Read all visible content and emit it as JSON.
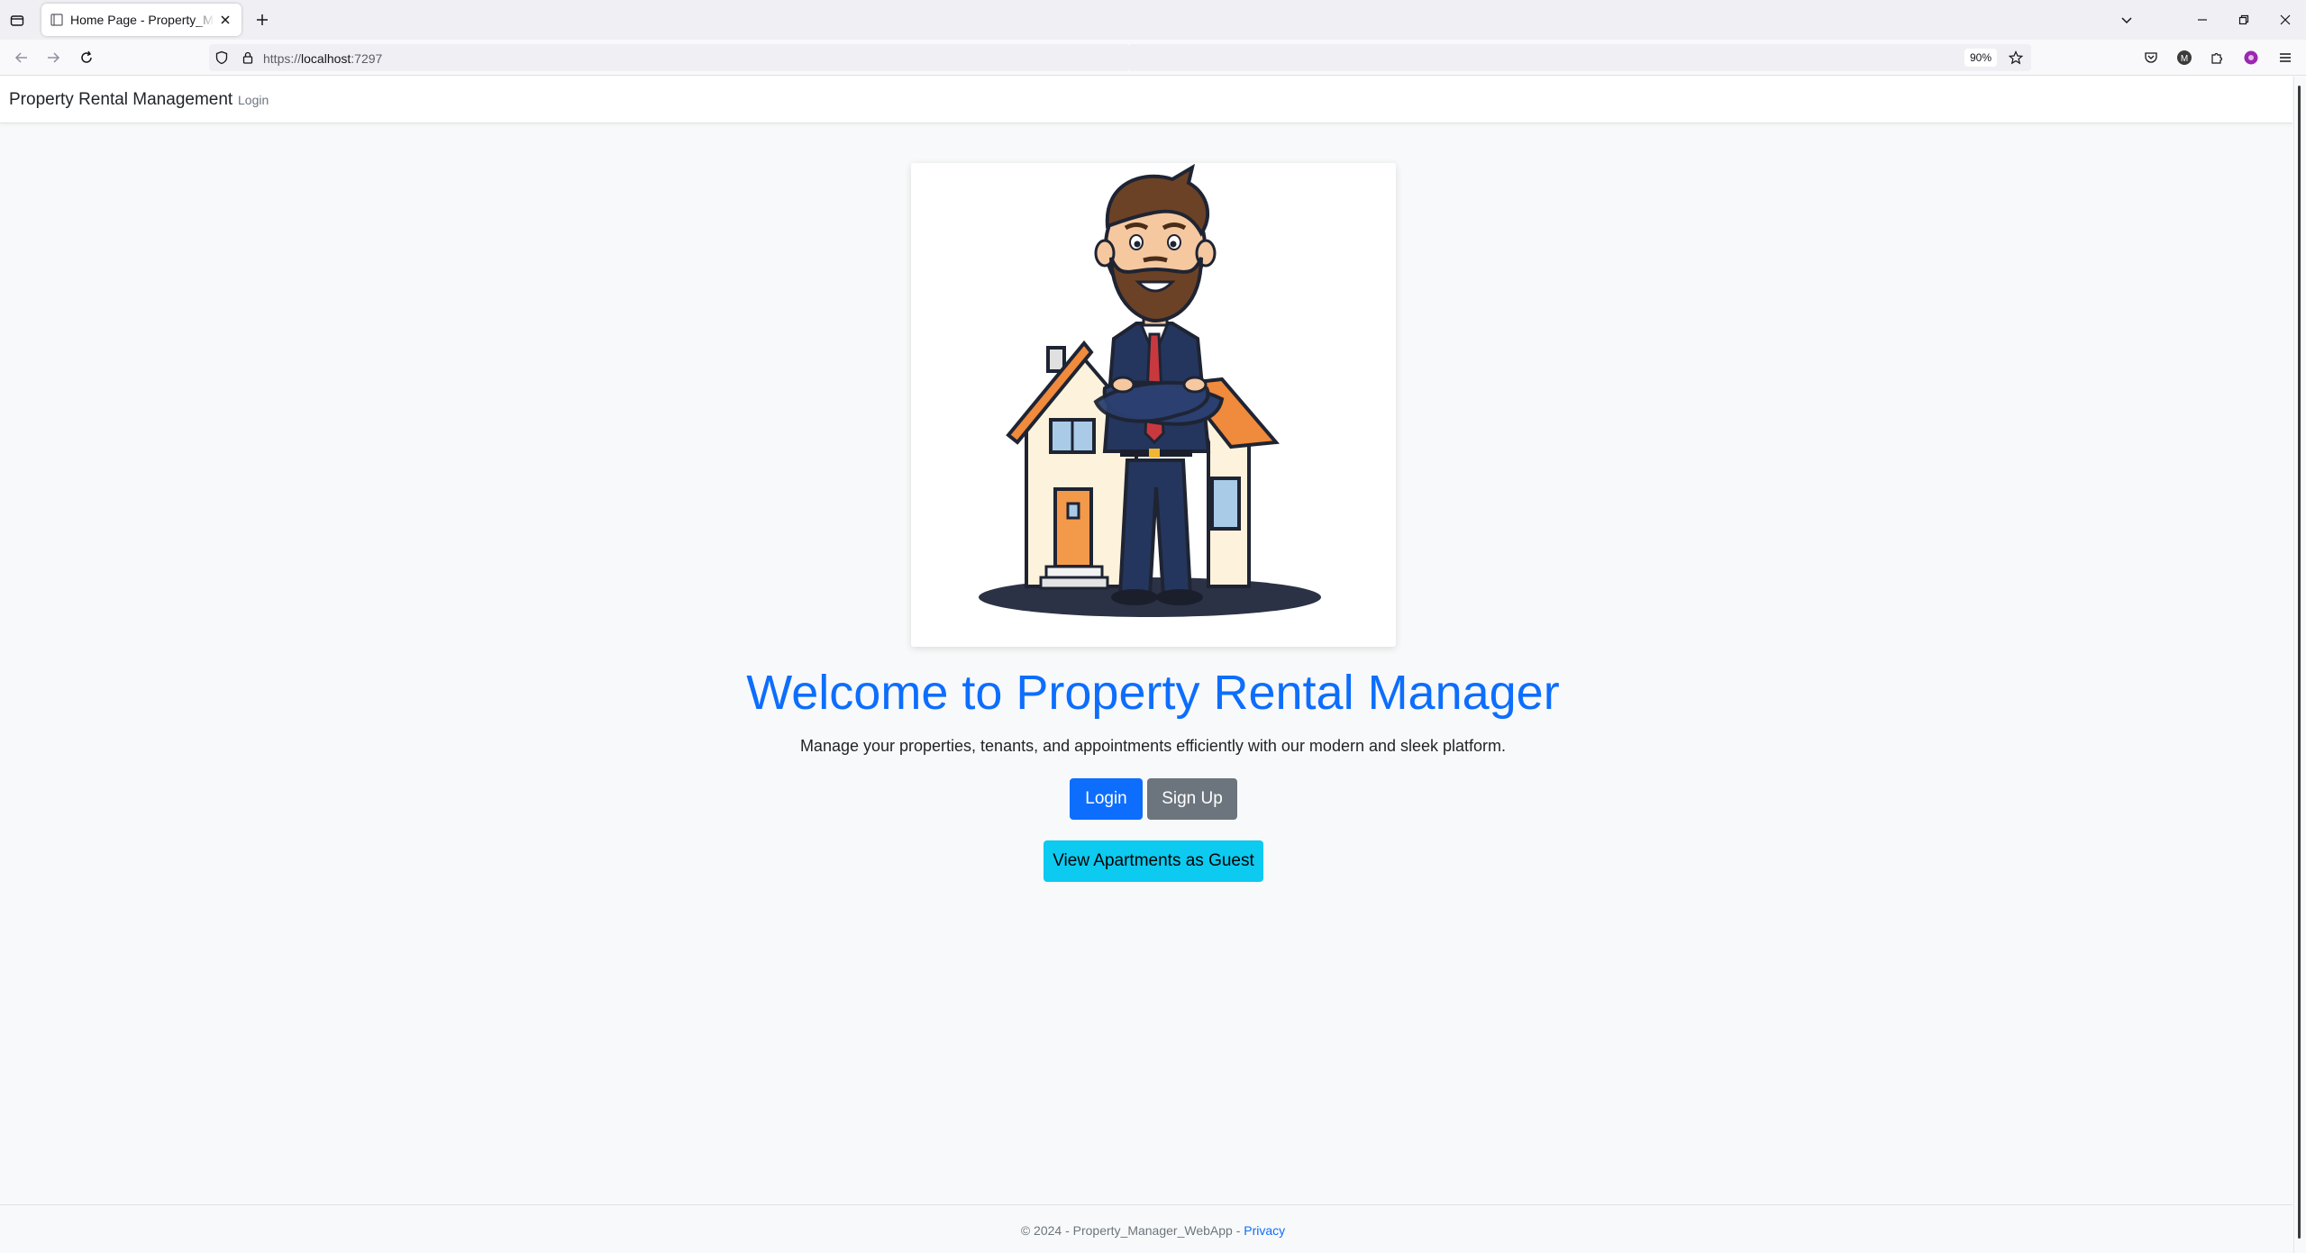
{
  "browser": {
    "tab_title": "Home Page - Property_Manager_WebApp",
    "url_prefix": "https://",
    "url_host": "localhost",
    "url_port": ":7297",
    "zoom": "90%"
  },
  "site": {
    "brand": "Property Rental Management",
    "nav_login": "Login"
  },
  "hero": {
    "title": "Welcome to Property Rental Manager",
    "subtitle": "Manage your properties, tenants, and appointments efficiently with our modern and sleek platform.",
    "login_label": "Login",
    "signup_label": "Sign Up",
    "guest_label": "View Apartments as Guest"
  },
  "footer": {
    "copyright": "© 2024 - Property_Manager_WebApp - ",
    "privacy": "Privacy"
  },
  "colors": {
    "primary": "#0d6efd",
    "secondary": "#6c757d",
    "info": "#0dcaf0"
  }
}
